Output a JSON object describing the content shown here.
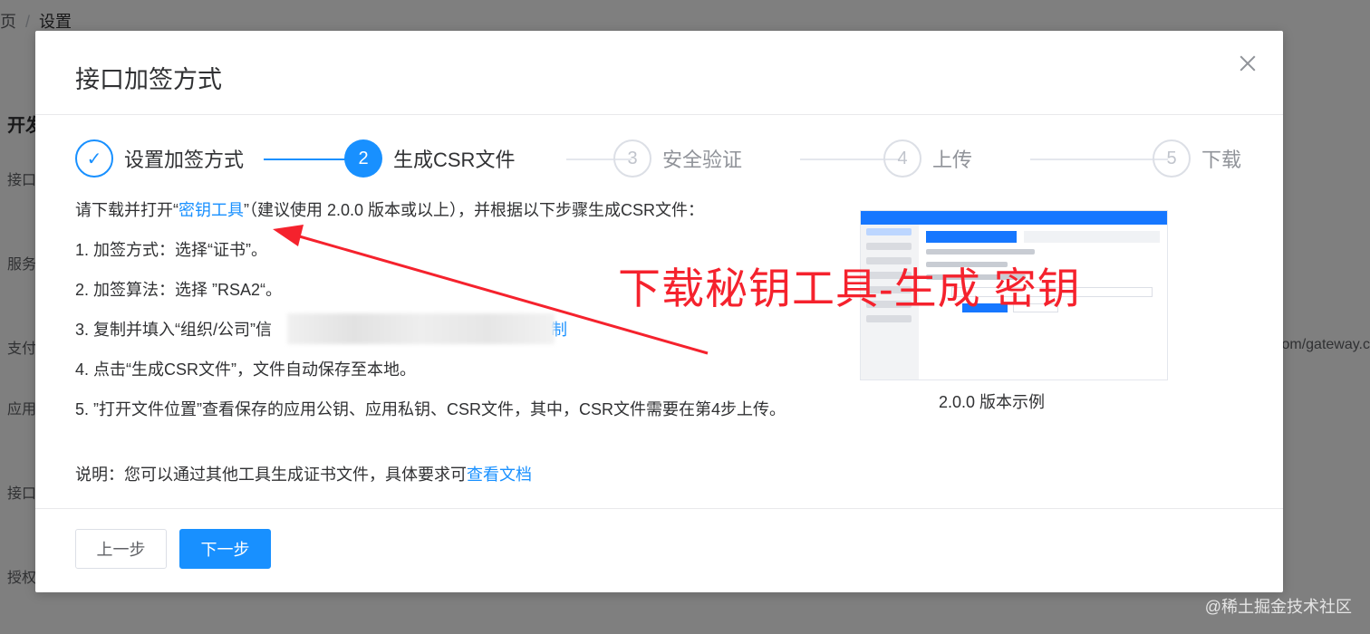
{
  "background": {
    "breadcrumb": [
      "页",
      "/",
      "设置"
    ],
    "title": "开发",
    "labels": [
      "接口",
      "服务",
      "支付",
      "应用",
      "接口",
      "授权"
    ],
    "right_text": "om/gateway.c"
  },
  "dialog": {
    "title": "接口加签方式",
    "steps": [
      {
        "index": "✓",
        "label": "设置加签方式",
        "status": "done"
      },
      {
        "index": "2",
        "label": "生成CSR文件",
        "status": "active"
      },
      {
        "index": "3",
        "label": "安全验证",
        "status": "wait"
      },
      {
        "index": "4",
        "label": "上传",
        "status": "wait"
      },
      {
        "index": "5",
        "label": "下载",
        "status": "wait"
      }
    ],
    "intro": {
      "before": "请下载并打开“",
      "link": "密钥工具",
      "after": "”（建议使用 2.0.0 版本或以上），并根据以下步骤生成CSR文件："
    },
    "items": [
      "1. 加签方式：选择“证书”。",
      "2. 加签算法：选择 ”RSA2“。",
      "3. 复制并填入“组织/公司”信",
      "4. 点击“生成CSR文件”，文件自动保存至本地。",
      "5. ”打开文件位置”查看保存的应用公钥、应用私钥、CSR文件，其中，CSR文件需要在第4步上传。"
    ],
    "copy_link": "复制",
    "note": {
      "before": "说明：您可以通过其他工具生成证书文件，具体要求可",
      "link": "查看文档"
    },
    "example_caption": "2.0.0 版本示例",
    "annotation": "下载秘钥工具-生成 密钥",
    "buttons": {
      "prev": "上一步",
      "next": "下一步"
    }
  },
  "watermark": "@稀土掘金技术社区",
  "colors": {
    "primary": "#1890ff",
    "annotation": "#f5222d"
  }
}
